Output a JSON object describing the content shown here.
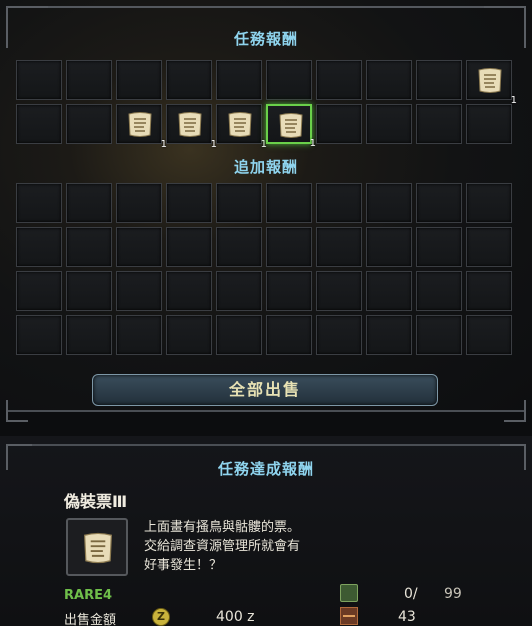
{
  "sections": {
    "quest_rewards": "任務報酬",
    "additional_rewards": "追加報酬",
    "quest_completion_rewards": "任務達成報酬"
  },
  "quest_rewards_grid": {
    "row1": [
      {
        "item": null
      },
      {
        "item": null
      },
      {
        "item": null
      },
      {
        "item": null
      },
      {
        "item": null
      },
      {
        "item": null
      },
      {
        "item": null
      },
      {
        "item": null
      },
      {
        "item": null
      },
      {
        "item": "ticket-icon",
        "qty": "1"
      }
    ],
    "row2": [
      {
        "item": null
      },
      {
        "item": null
      },
      {
        "item": "ticket-icon",
        "qty": "1"
      },
      {
        "item": "ticket-icon",
        "qty": "1"
      },
      {
        "item": "ticket-icon",
        "qty": "1"
      },
      {
        "item": "ticket-icon",
        "qty": "1",
        "selected": true
      },
      {
        "item": null
      },
      {
        "item": null
      },
      {
        "item": null
      },
      {
        "item": null
      }
    ]
  },
  "additional_rewards_grid": {
    "rows": 4,
    "cols": 10
  },
  "buttons": {
    "sell_all": "全部出售"
  },
  "detail": {
    "name": "偽裝票Ⅲ",
    "description": [
      "上面畫有搔鳥與骷髏的票。",
      "交給調查資源管理所就會有",
      "好事發生！？"
    ],
    "rarity": "RARE4",
    "sell_label": "出售金額",
    "zenny_symbol": "Z",
    "price": "400 z",
    "owned": "0/",
    "max": "99",
    "box_count": "43"
  },
  "colors": {
    "accent": "#8fd4ee",
    "rare": "#6fbf4a",
    "selected": "#6ad04a"
  }
}
